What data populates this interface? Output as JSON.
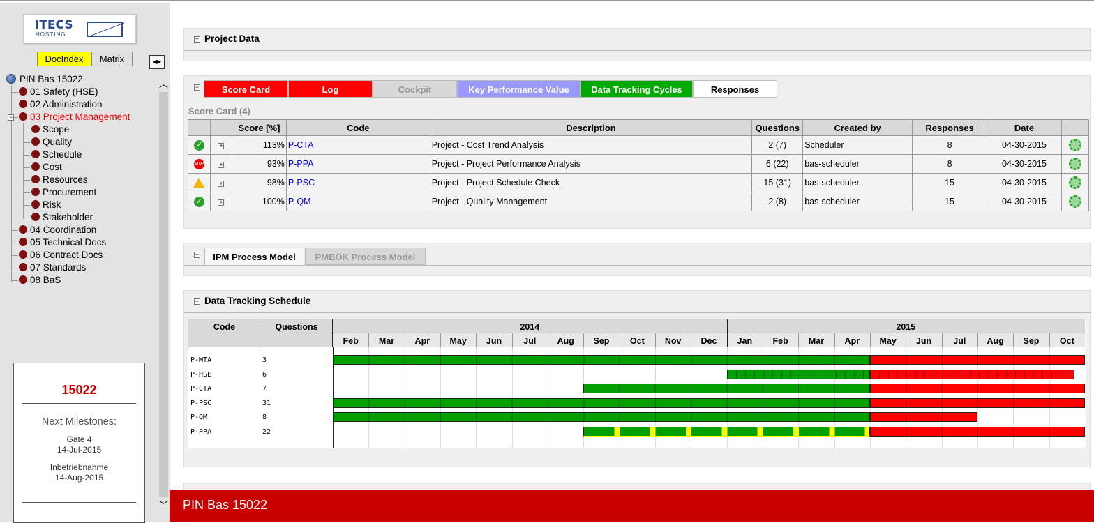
{
  "sidebar": {
    "logo_top": "ITECS",
    "logo_bottom": "HOSTING",
    "tab_docindex": "DocIndex",
    "tab_matrix": "Matrix",
    "tree_root": "PIN Bas 15022",
    "tree_items": [
      "01 Safety (HSE)",
      "02 Administration",
      "03 Project Management",
      "Scope",
      "Quality",
      "Schedule",
      "Cost",
      "Resources",
      "Procurement",
      "Risk",
      "Stakeholder",
      "04 Coordination",
      "05 Technical Docs",
      "06 Contract Docs",
      "07 Standards",
      "08 BaS"
    ],
    "milestones": {
      "number": "15022",
      "title": "Next Milestones:",
      "items": [
        {
          "name": "Gate 4",
          "date": "14-Jul-2015"
        },
        {
          "name": "Inbetriebnahme",
          "date": "14-Aug-2015"
        }
      ]
    }
  },
  "project_data": {
    "title": "Project Data"
  },
  "scorecard_tabs": [
    {
      "label": "Score Card",
      "bg": "#ff0000",
      "fg": "#ffffff"
    },
    {
      "label": "Log",
      "bg": "#ff0000",
      "fg": "#ffffff"
    },
    {
      "label": "Cockpit",
      "bg": "#d8d8d8",
      "fg": "#999999"
    },
    {
      "label": "Key Performance Value",
      "bg": "#9999ff",
      "fg": "#ffffff"
    },
    {
      "label": "Data Tracking Cycles",
      "bg": "#00aa00",
      "fg": "#ffffff"
    },
    {
      "label": "Responses",
      "bg": "#ffffff",
      "fg": "#000000"
    }
  ],
  "scorecard": {
    "caption": "Score Card (4)",
    "headers": [
      "",
      "",
      "Score [%]",
      "Code",
      "Description",
      "Questions",
      "Created by",
      "Responses",
      "Date",
      ""
    ],
    "rows": [
      {
        "status": "ok",
        "score": "113%",
        "code": "P-CTA",
        "description": "Project - Cost Trend Analysis",
        "questions": "2 (7)",
        "created_by": "Scheduler",
        "responses": "8",
        "date": "04-30-2015"
      },
      {
        "status": "stop",
        "score": "93%",
        "code": "P-PPA",
        "description": "Project - Project Performance Analysis",
        "questions": "6 (22)",
        "created_by": "bas-scheduler",
        "responses": "8",
        "date": "04-30-2015"
      },
      {
        "status": "warn",
        "score": "98%",
        "code": "P-PSC",
        "description": "Project - Project Schedule Check",
        "questions": "15 (31)",
        "created_by": "bas-scheduler",
        "responses": "15",
        "date": "04-30-2015"
      },
      {
        "status": "ok",
        "score": "100%",
        "code": "P-QM",
        "description": "Project - Quality Management",
        "questions": "2 (8)",
        "created_by": "bas-scheduler",
        "responses": "15",
        "date": "04-30-2015"
      }
    ]
  },
  "process_tabs": [
    "IPM Process Model",
    "PMBOK Process Model"
  ],
  "tracking": {
    "title": "Data Tracking Schedule",
    "col_code": "Code",
    "col_questions": "Questions",
    "years": [
      "2014",
      "2015"
    ],
    "months": [
      "Feb",
      "Mar",
      "Apr",
      "May",
      "Jun",
      "Jul",
      "Aug",
      "Sep",
      "Oct",
      "Nov",
      "Dec",
      "Jan",
      "Feb",
      "Mar",
      "Apr",
      "May",
      "Jun",
      "Jul",
      "Aug",
      "Sep",
      "Oct"
    ],
    "rows": [
      {
        "code": "P-MTA",
        "questions": "3",
        "segments": [
          {
            "from": 0,
            "to": 15,
            "color": "green"
          },
          {
            "from": 15,
            "to": 21,
            "color": "red"
          }
        ]
      },
      {
        "code": "P-HSE",
        "questions": "6",
        "segments": [
          {
            "from": 11,
            "to": 15,
            "color": "green-fine"
          },
          {
            "from": 15,
            "to": 20.7,
            "color": "red-fine"
          }
        ]
      },
      {
        "code": "P-CTA",
        "questions": "7",
        "segments": [
          {
            "from": 7,
            "to": 15,
            "color": "green"
          },
          {
            "from": 15,
            "to": 21,
            "color": "red"
          }
        ]
      },
      {
        "code": "P-PSC",
        "questions": "31",
        "segments": [
          {
            "from": 0,
            "to": 15,
            "color": "green"
          },
          {
            "from": 15,
            "to": 21,
            "color": "red"
          }
        ]
      },
      {
        "code": "P-QM",
        "questions": "8",
        "segments": [
          {
            "from": 0,
            "to": 15,
            "color": "green"
          },
          {
            "from": 15,
            "to": 18,
            "color": "red"
          }
        ]
      },
      {
        "code": "P-PPA",
        "questions": "22",
        "segments": [
          {
            "from": 7,
            "to": 15,
            "color": "green-yellow"
          },
          {
            "from": 15,
            "to": 21,
            "color": "red"
          }
        ]
      }
    ]
  },
  "footer": {
    "title": "PIN Bas 15022"
  }
}
